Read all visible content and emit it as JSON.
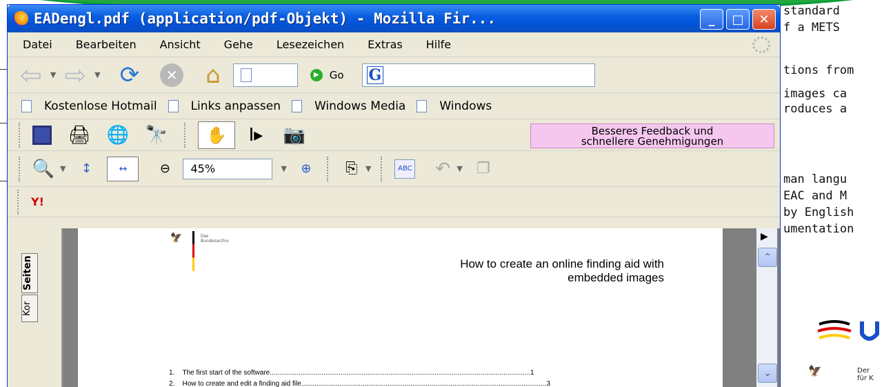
{
  "window": {
    "title": "EADengl.pdf (application/pdf-Objekt) - Mozilla Fir...",
    "min_glyph": "_",
    "max_glyph": "□",
    "close_glyph": "✕"
  },
  "menu": [
    "Datei",
    "Bearbeiten",
    "Ansicht",
    "Gehe",
    "Lesezeichen",
    "Extras",
    "Hilfe"
  ],
  "nav": {
    "go_label": "Go"
  },
  "bookmarks": [
    "Kostenlose Hotmail",
    "Links anpassen",
    "Windows Media",
    "Windows"
  ],
  "toolbar": {
    "feedback_line1": "Besseres Feedback und",
    "feedback_line2": "schnellere Genehmigungen",
    "zoom": "45%",
    "spell": "ABC"
  },
  "yahoo": "Y!",
  "side_tabs": {
    "pages": "Seiten",
    "comments": "Kor"
  },
  "document": {
    "org_line1": "Das",
    "org_line2": "Bundesarchiv",
    "title_line1": "How to create an online finding aid with",
    "title_line2": "embedded images",
    "toc": [
      {
        "num": "1.",
        "text": "The first start of the software",
        "page": "1"
      },
      {
        "num": "2.",
        "text": "How to create and edit a finding aid file",
        "page": "3"
      }
    ]
  },
  "background_text": [
    "standard",
    "f a METS",
    "tions from",
    "images ca",
    "roduces a",
    "man langu",
    "EAC and M",
    "by English",
    "umentation"
  ],
  "background_org": {
    "line1": "Der",
    "line2": "für K"
  },
  "colors": {
    "title_bar": "#0453d8",
    "feedback_bg": "#f5c7ef",
    "accent_green": "#22a83f"
  }
}
